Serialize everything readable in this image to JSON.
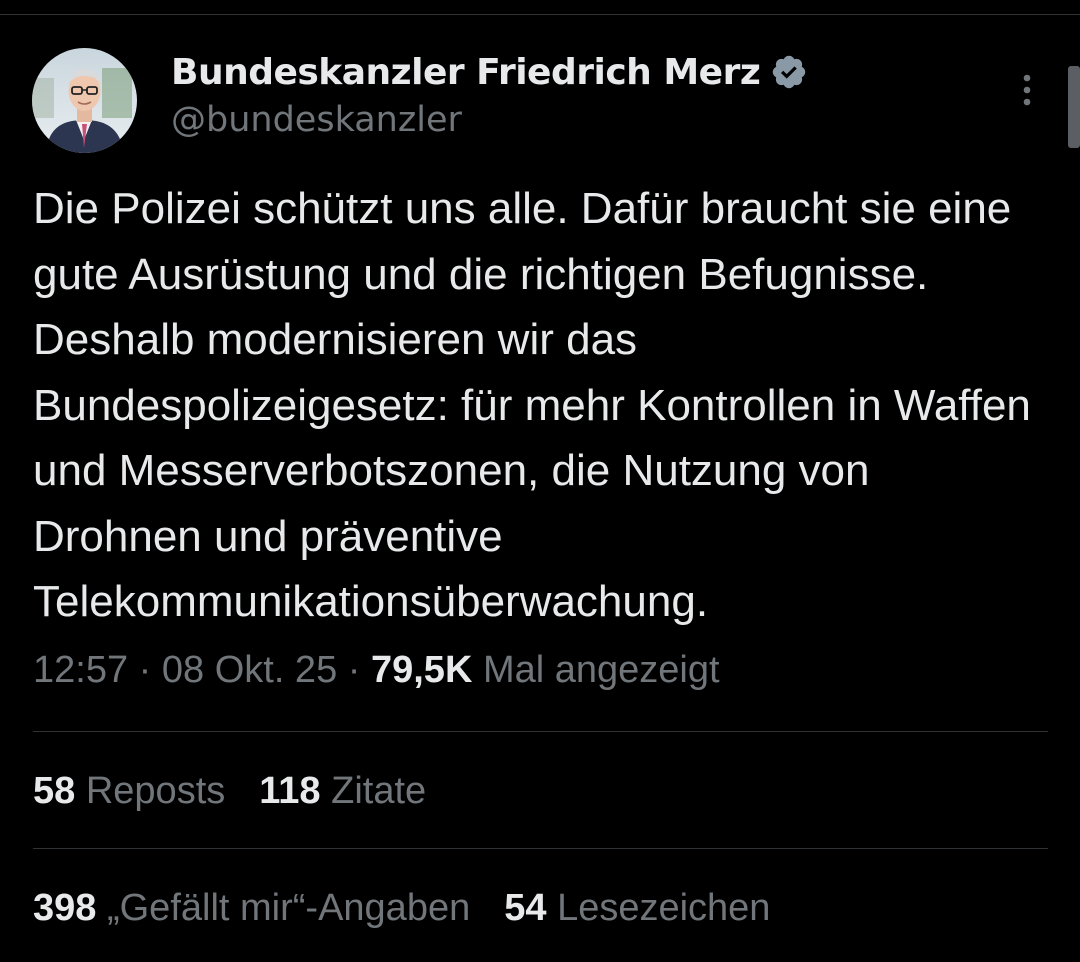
{
  "author": {
    "name": "Bundeskanzler Friedrich Merz",
    "handle": "@bundeskanzler",
    "verified_icon": "verified-badge-icon",
    "verified_color": "#8a99a6"
  },
  "tweet": {
    "text": "Die Polizei schützt uns alle. Dafür braucht sie eine gute Ausrüstung und die richtigen Befugnisse. Deshalb modernisieren wir das Bundespolizeigesetz: für mehr Kontrollen in Waffen und Messerverbotszonen, die Nutzung von Drohnen und präventive Telekommunikationsüberwachung.",
    "time": "12:57",
    "separator": "·",
    "date": "08 Okt. 25",
    "views_count": "79,5K",
    "views_label": "Mal angezeigt"
  },
  "stats": {
    "reposts_count": "58",
    "reposts_label": "Reposts",
    "quotes_count": "118",
    "quotes_label": "Zitate",
    "likes_count": "398",
    "likes_label": "„Gefällt mir“-Angaben",
    "bookmarks_count": "54",
    "bookmarks_label": "Lesezeichen"
  },
  "colors": {
    "background": "#000000",
    "text_primary": "#e7e9ea",
    "text_secondary": "#71767b",
    "divider": "#2f3336"
  },
  "icons": {
    "more": "more-vertical-icon"
  }
}
